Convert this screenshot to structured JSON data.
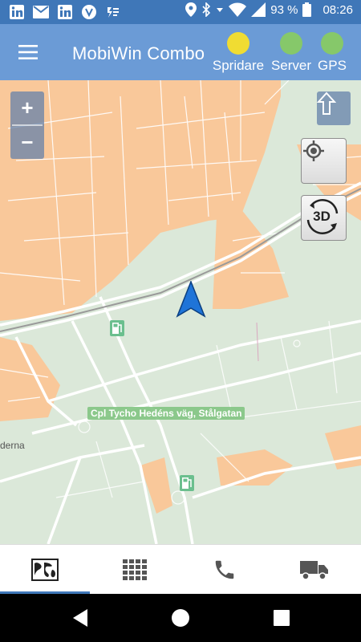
{
  "status_bar": {
    "battery": "93 %",
    "time": "08:26",
    "icons": [
      "linkedin-icon",
      "mail-icon",
      "linkedin-icon",
      "app-icon",
      "check-icon",
      "location-icon",
      "bluetooth-icon",
      "wifi-icon",
      "signal-icon",
      "battery-icon"
    ]
  },
  "app_bar": {
    "title": "MobiWin Combo",
    "indicators": [
      {
        "label": "Spridare",
        "color": "#f0dc32"
      },
      {
        "label": "Server",
        "color": "#86c86a"
      },
      {
        "label": "GPS",
        "color": "#86c86a"
      }
    ]
  },
  "map": {
    "zoom_in": "+",
    "zoom_out": "−",
    "button_3d": "3D",
    "poi_label": "Cpl Tycho Hedéns väg, Stålgatan",
    "place_label": "derna"
  },
  "bottom_nav": {
    "items": [
      "map-icon",
      "grid-icon",
      "phone-icon",
      "truck-icon"
    ],
    "active_index": 0
  },
  "colors": {
    "status_bar": "#3f77b8",
    "app_bar": "#6b9bd6",
    "map_green": "#dbe8d9",
    "map_orange": "#f9c89a",
    "nav_marker": "#1f74d8"
  }
}
